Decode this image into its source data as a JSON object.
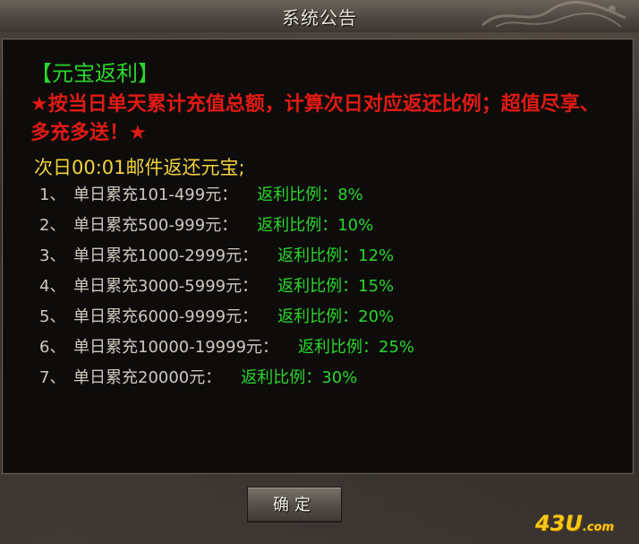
{
  "window": {
    "title": "系统公告"
  },
  "notice": {
    "heading": "【元宝返利】",
    "highlight": "★按当日单天累计充值总额，计算次日对应返还比例；超值尽享、多充多送！★",
    "mail_line": "次日00:01邮件返还元宝;"
  },
  "tiers": [
    {
      "index": "1、",
      "desc": "单日累充101-499元：",
      "rate": "返利比例：8%"
    },
    {
      "index": "2、",
      "desc": "单日累充500-999元：",
      "rate": "返利比例：10%"
    },
    {
      "index": "3、",
      "desc": "单日累充1000-2999元：",
      "rate": "返利比例：12%"
    },
    {
      "index": "4、",
      "desc": "单日累充3000-5999元：",
      "rate": "返利比例：15%"
    },
    {
      "index": "5、",
      "desc": "单日累充6000-9999元：",
      "rate": "返利比例：20%"
    },
    {
      "index": "6、",
      "desc": "单日累充10000-19999元：",
      "rate": "返利比例：25%"
    },
    {
      "index": "7、",
      "desc": "单日累充20000元：",
      "rate": "返利比例：30%"
    }
  ],
  "footer": {
    "confirm_label": "确定",
    "watermark_main": "43U",
    "watermark_domain": ".com"
  },
  "colors": {
    "heading": "#2bd62b",
    "highlight": "#e01a14",
    "mail_line": "#f2d23a",
    "tier_text": "#cfc8bd",
    "rate_text": "#2bd62b"
  }
}
